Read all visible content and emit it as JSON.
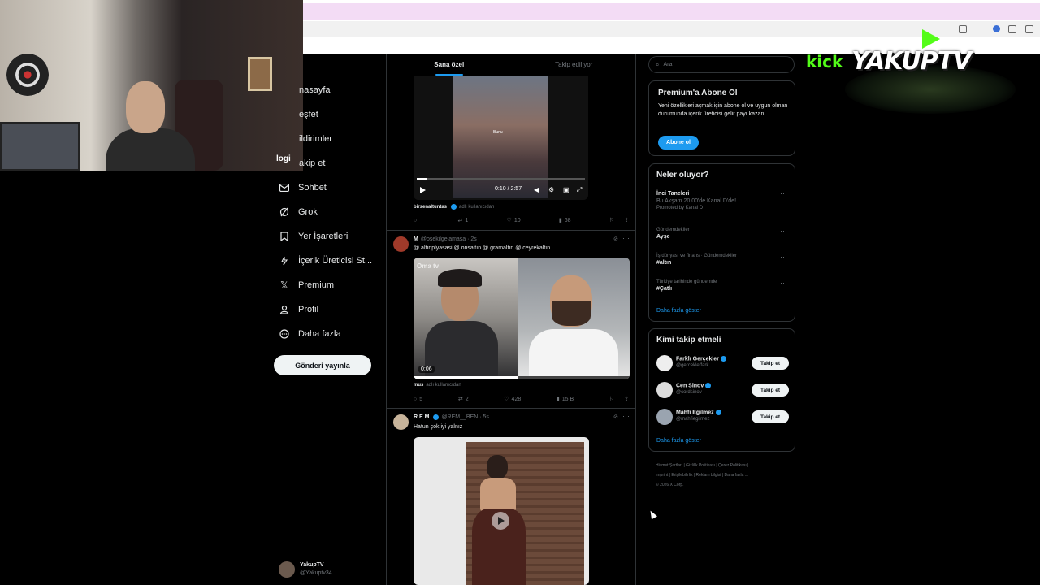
{
  "webcam": {
    "logo_label": "logi"
  },
  "nav": {
    "items": [
      {
        "label": "nasayfa",
        "icon": "home-icon"
      },
      {
        "label": "eşfet",
        "icon": "search-icon"
      },
      {
        "label": "ildirimler",
        "icon": "bell-icon"
      },
      {
        "label": "akip et",
        "icon": "people-icon"
      },
      {
        "label": "Sohbet",
        "icon": "mail-icon"
      },
      {
        "label": "Grok",
        "icon": "grok-icon"
      },
      {
        "label": "Yer İşaretleri",
        "icon": "bookmark-icon"
      },
      {
        "label": "İçerik Üreticisi St...",
        "icon": "bolt-icon"
      },
      {
        "label": "Premium",
        "icon": "x-logo-icon"
      },
      {
        "label": "Profil",
        "icon": "person-icon"
      },
      {
        "label": "Daha fazla",
        "icon": "more-circle-icon"
      }
    ],
    "post_button": "Gönderi yayınla",
    "account": {
      "name": "YakupTV",
      "handle": "@Yakuptv34"
    }
  },
  "feed": {
    "tabs": [
      "Sana özel",
      "Takip ediliyor"
    ],
    "post1": {
      "video_time": "0:10 / 2:57",
      "video_caption": "Bunu",
      "footer_user": "birsenaltuntas",
      "footer_note": "adlı kullanıcıdan",
      "stats": {
        "replies": "",
        "reposts": "1",
        "likes": "10",
        "views": "68"
      }
    },
    "post2": {
      "author": "M",
      "handle": "@osekilgelamasa · 2s",
      "text": "@.altınplyasasi @.onsaltın @.gramaltın @.ceyrekaltın",
      "video_duration": "0:06",
      "watermark": "Oma tv",
      "footer_user": "mus",
      "footer_note": "adlı kullanıcıdan",
      "stats": {
        "replies": "5",
        "reposts": "2",
        "likes": "428",
        "views": "15 B"
      }
    },
    "post3": {
      "author": "R E M",
      "handle": "@REM__BEN · 5s",
      "text": "Hatun çok iyi yalnız"
    }
  },
  "right": {
    "search_placeholder": "Ara",
    "premium": {
      "title": "Premium'a Abone Ol",
      "text": "Yeni özellikleri açmak için abone ol ve uygun olman durumunda içerik üreticisi gelir payı kazan.",
      "button": "Abone ol"
    },
    "trends": {
      "title": "Neler oluyor?",
      "items": [
        {
          "context": "",
          "title": "İnci Taneleri",
          "sub": "Bu Akşam 20.00'de Kanal D'de!",
          "promo": "Promoted by Kanal D"
        },
        {
          "context": "Gündemdekiler",
          "title": "Ayşe",
          "sub": "",
          "promo": ""
        },
        {
          "context": "İş dünyası ve finans · Gündemdekiler",
          "title": "#altın",
          "sub": "",
          "promo": ""
        },
        {
          "context": "Türkiye tarihinde gündemde",
          "title": "#Çatlı",
          "sub": "",
          "promo": ""
        }
      ],
      "more": "Daha fazla göster"
    },
    "who_to_follow": {
      "title": "Kimi takip etmeli",
      "items": [
        {
          "name": "Farklı Gerçekler",
          "handle": "@gercekleffark",
          "button": "Takip et"
        },
        {
          "name": "Cen Sinov",
          "handle": "@cordsinov",
          "button": "Takip et"
        },
        {
          "name": "Mahfi Eğilmez",
          "handle": "@mahfiegilmez",
          "button": "Takip et"
        }
      ],
      "more": "Daha fazla göster"
    },
    "footer": {
      "line1": "Hizmet Şartları  |  Gizlilik Politikası  |  Çerez Politikası  |",
      "line2": "Imprint  |  Erişilebilirlik  |  Reklam bilgisi  |  Daha fazla ...",
      "line3": "© 2026 X Corp."
    }
  },
  "overlay": {
    "kick": "kick",
    "brand": "YAKUPTV"
  },
  "colors": {
    "accent": "#1d9bf0",
    "kick_green": "#53fc18",
    "background": "#000000"
  }
}
